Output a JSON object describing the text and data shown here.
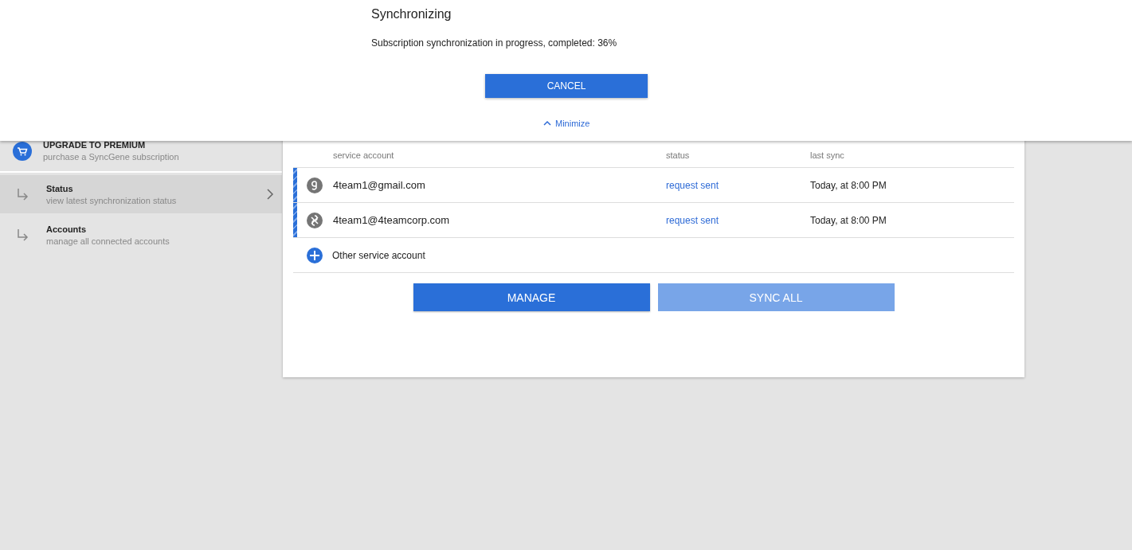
{
  "dialog": {
    "title": "Synchronizing",
    "message": "Subscription synchronization in progress, completed: 36%",
    "cancel": "CANCEL",
    "minimize": "Minimize"
  },
  "sidebar": {
    "upgrade": {
      "title": "UPGRADE TO PREMIUM",
      "subtitle": "purchase a SyncGene subscription"
    },
    "items": [
      {
        "title": "Status",
        "subtitle": "view latest synchronization status",
        "selected": true
      },
      {
        "title": "Accounts",
        "subtitle": "manage all connected accounts",
        "selected": false
      }
    ]
  },
  "table": {
    "columns": [
      "service account",
      "status",
      "last sync"
    ],
    "rows": [
      {
        "kind": "google",
        "account": "4team1@gmail.com",
        "status": "request sent",
        "last_sync": "Today, at 8:00 PM"
      },
      {
        "kind": "corp",
        "account": "4team1@4teamcorp.com",
        "status": "request sent",
        "last_sync": "Today, at 8:00 PM"
      }
    ],
    "add": "Other service account"
  },
  "buttons": [
    {
      "label": "MANAGE",
      "disabled": false
    },
    {
      "label": "SYNC ALL",
      "disabled": true
    }
  ]
}
